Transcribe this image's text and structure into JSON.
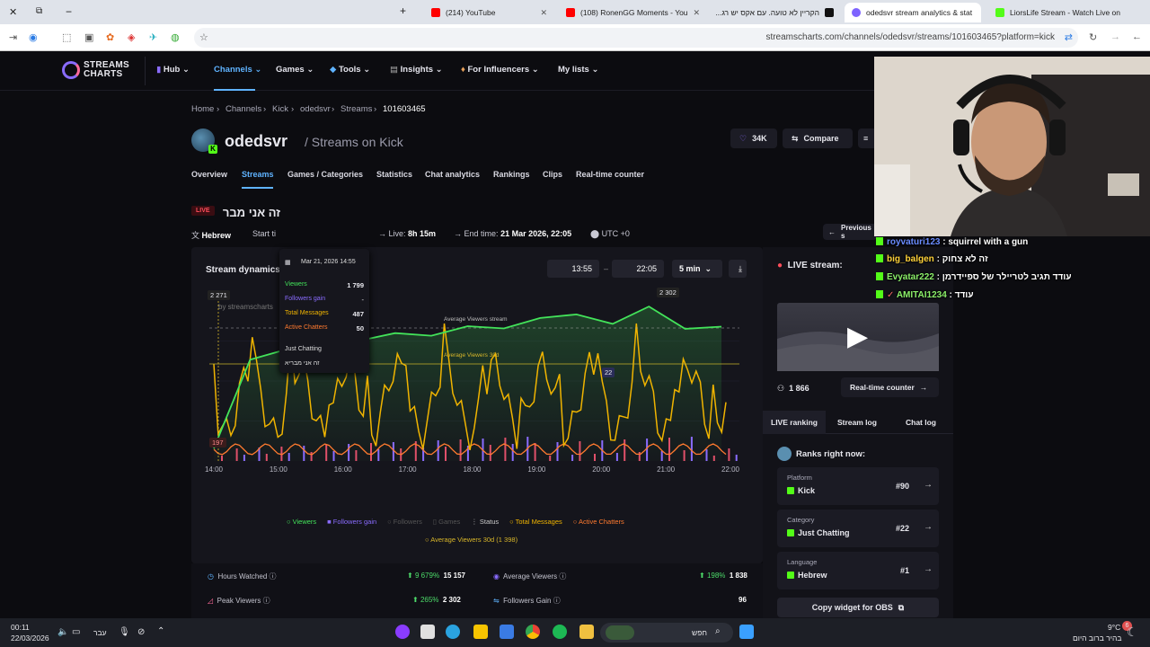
{
  "browser": {
    "tabs": [
      {
        "title": "(214) YouTube",
        "icon": "youtube-icon"
      },
      {
        "title": "(108) RonenGG Moments - You",
        "icon": "youtube-icon"
      },
      {
        "title": "הקריין לא טועה. עם אקס יש רג...",
        "icon": "tiktok-icon"
      },
      {
        "title": "odedsvr stream analytics & stat",
        "icon": "streamscharts-icon"
      },
      {
        "title": "LiorsLife Stream - Watch Live on",
        "icon": "kick-icon"
      }
    ],
    "url": "streamscharts.com/channels/odedsvr/streams/101603465?platform=kick"
  },
  "site": {
    "logo": {
      "line1": "STREAMS",
      "line2": "CHARTS"
    },
    "nav": [
      "Hub",
      "Channels",
      "Games",
      "Tools",
      "Insights",
      "For Influencers",
      "My lists"
    ],
    "breadcrumb": [
      "Home",
      "Channels",
      "Kick",
      "odedsvr",
      "Streams",
      "101603465"
    ],
    "channel_name": "odedsvr",
    "channel_subtitle": "/ Streams on Kick",
    "likes": "34K",
    "compare_label": "Compare",
    "subtabs": [
      "Overview",
      "Streams",
      "Games / Categories",
      "Statistics",
      "Chat analytics",
      "Rankings",
      "Clips",
      "Real-time counter"
    ],
    "live_badge": "LIVE",
    "stream_title": "זה אני מבריא",
    "meta": {
      "language": "Hebrew",
      "start_label": "Start ti",
      "live_label": "Live:",
      "live_value": "8h 15m",
      "end_label": "End time:",
      "end_value": "21 Mar 2026, 22:05",
      "tz": "UTC +0",
      "previous": "Previous s"
    }
  },
  "chart_panel": {
    "title": "Stream dynamics",
    "from": "13:55",
    "to": "22:05",
    "interval": "5 min",
    "watermark": "by streamscharts",
    "avg30_label": "Average Viewers 30d",
    "avg_stream_label": "Average Viewers stream",
    "label_peak": "2 271",
    "label_min": "197",
    "label_peak2": "2 302",
    "label_followers": "22",
    "legend": [
      "Viewers",
      "Followers gain",
      "Followers",
      "Games",
      "Status",
      "Total Messages",
      "Active Chatters"
    ],
    "legend2": "Average Viewers 30d (1 398)",
    "tooltip": {
      "date": "Mar 21, 2026 14:55",
      "viewers_label": "Viewers",
      "viewers_value": "1 799",
      "followers_label": "Followers gain",
      "followers_value": "-",
      "messages_label": "Total Messages",
      "messages_value": "487",
      "chatters_label": "Active Chatters",
      "chatters_value": "50",
      "category": "Just Chatting",
      "title": "זה אני מבריא"
    }
  },
  "chart_data": {
    "type": "line",
    "x_ticks": [
      "14:00",
      "15:00",
      "16:00",
      "17:00",
      "18:00",
      "19:00",
      "20:00",
      "21:00",
      "22:00"
    ],
    "series": [
      {
        "name": "Viewers",
        "color": "#43e35a",
        "values": [
          197,
          1500,
          1799,
          1850,
          1950,
          1970,
          2000,
          2050,
          2100,
          2150,
          2150,
          2200,
          2302,
          2150,
          2100
        ]
      },
      {
        "name": "Average Viewers 30d",
        "color": "#d8b62a",
        "value": 1398
      }
    ],
    "annotations": [
      "2 271",
      "197",
      "2 302",
      "22"
    ]
  },
  "stats": {
    "hours_watched_label": "Hours Watched",
    "hours_watched_change": "9 679%",
    "hours_watched_value": "15 157",
    "avg_viewers_label": "Average Viewers",
    "avg_viewers_change": "198%",
    "avg_viewers_value": "1 838",
    "peak_viewers_label": "Peak Viewers",
    "peak_viewers_change": "265%",
    "peak_viewers_value": "2 302",
    "followers_gain_label": "Followers Gain",
    "followers_gain_value": "96"
  },
  "right_panel": {
    "live_stream_label": "LIVE stream:",
    "viewers": "1 866",
    "realtime_btn": "Real-time counter",
    "tabs": [
      "LIVE ranking",
      "Stream log",
      "Chat log"
    ],
    "ranks_title": "Ranks right now:",
    "ranks": [
      {
        "label": "Platform",
        "value": "Kick",
        "rank": "#90"
      },
      {
        "label": "Category",
        "value": "Just Chatting",
        "rank": "#22"
      },
      {
        "label": "Language",
        "value": "Hebrew",
        "rank": "#1"
      }
    ],
    "widget_btn": "Copy widget for OBS"
  },
  "overlay_chat": [
    {
      "user": "royvaturi123",
      "user_color": "#6a8cff",
      "msg": "squirrel with a gun"
    },
    {
      "user": "big_balgen",
      "user_color": "#ffd23a",
      "msg": "זה לא צחוק"
    },
    {
      "user": "Evyatar222",
      "user_color": "#8cf06a",
      "msg": "עודד תגיב לטריילר של ספיידרמן"
    },
    {
      "user": "AMITAI1234",
      "user_color": "#ff6a6a",
      "msg": "עודד"
    }
  ],
  "taskbar": {
    "time": "00:11",
    "date": "22/03/2026",
    "lang": "עבר",
    "search": "חפש",
    "weather_temp": "9°C",
    "weather_desc": "בהיר ברוב היום",
    "notif_count": "6"
  },
  "colors": {
    "accent": "#5fb3ff",
    "viewers": "#43e35a",
    "messages": "#f0b400",
    "chatters": "#ff7a2f",
    "followers": "#8a6cff",
    "kick": "#53fc18"
  }
}
